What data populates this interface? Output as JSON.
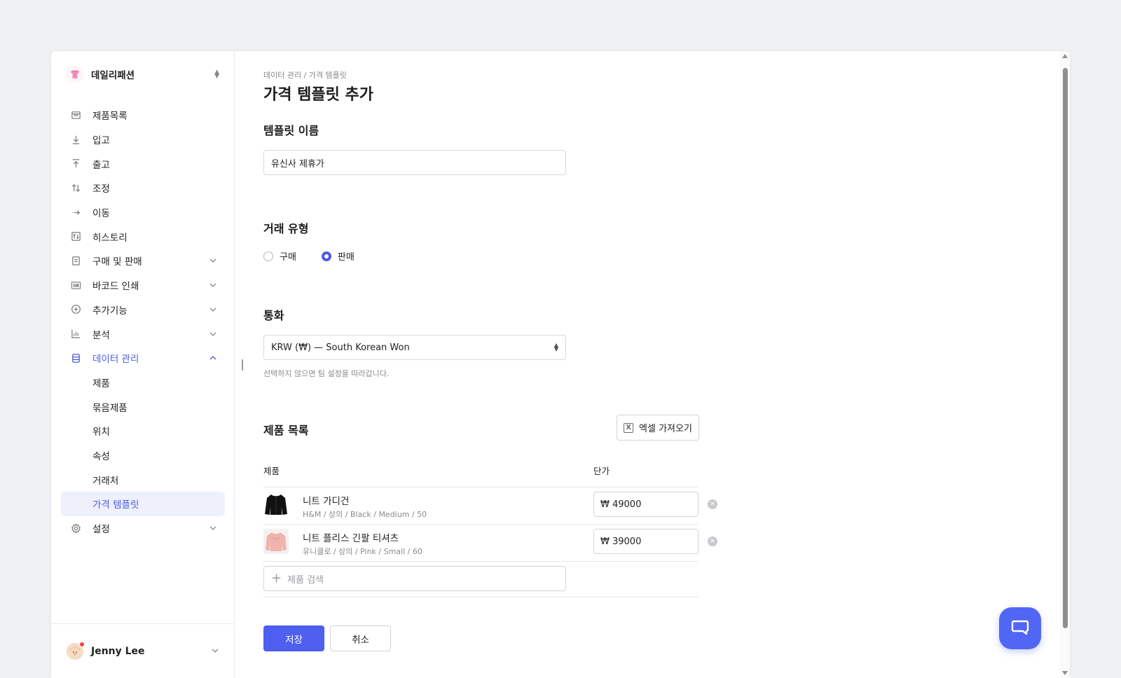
{
  "brand": {
    "name": "데일리패션"
  },
  "nav": {
    "items": [
      {
        "label": "제품목록"
      },
      {
        "label": "입고"
      },
      {
        "label": "출고"
      },
      {
        "label": "조정"
      },
      {
        "label": "이동"
      },
      {
        "label": "히스토리"
      },
      {
        "label": "구매 및 판매"
      },
      {
        "label": "바코드 인쇄"
      },
      {
        "label": "추가기능"
      },
      {
        "label": "분석"
      },
      {
        "label": "데이터 관리"
      }
    ],
    "sub": [
      {
        "label": "제품"
      },
      {
        "label": "묶음제품"
      },
      {
        "label": "위치"
      },
      {
        "label": "속성"
      },
      {
        "label": "거래처"
      },
      {
        "label": "가격 템플릿"
      }
    ],
    "settings": {
      "label": "설정"
    }
  },
  "user": {
    "name": "Jenny Lee"
  },
  "main": {
    "breadcrumb": "데이터 관리 / 가격 템플릿",
    "title": "가격 템플릿 추가",
    "template_name": {
      "label": "템플릿 이름",
      "value": "유신사 제휴가"
    },
    "trade_type": {
      "label": "거래 유형",
      "options": [
        "구매",
        "판매"
      ],
      "selected": "판매"
    },
    "currency": {
      "label": "통화",
      "value": "KRW (₩) — South Korean Won",
      "hint": "선택하지 않으면 팀 설정을 따라갑니다."
    },
    "products": {
      "label": "제품 목록",
      "excel_button": "엑셀 가져오기",
      "col_product": "제품",
      "col_price": "단가",
      "rows": [
        {
          "name": "니트 가디건",
          "meta": "H&M / 상의 / Black / Medium / 50",
          "price": "₩ 49000"
        },
        {
          "name": "니트 플리스 긴팔 티셔츠",
          "meta": "유니클로 / 상의 / Pink / Small / 60",
          "price": "₩ 39000"
        }
      ],
      "search_placeholder": "제품 검색"
    },
    "save_label": "저장",
    "cancel_label": "취소"
  },
  "colors": {
    "accent": "#4e5ce0",
    "primary_button": "#4f5fef",
    "chat_button": "#5266f5"
  }
}
